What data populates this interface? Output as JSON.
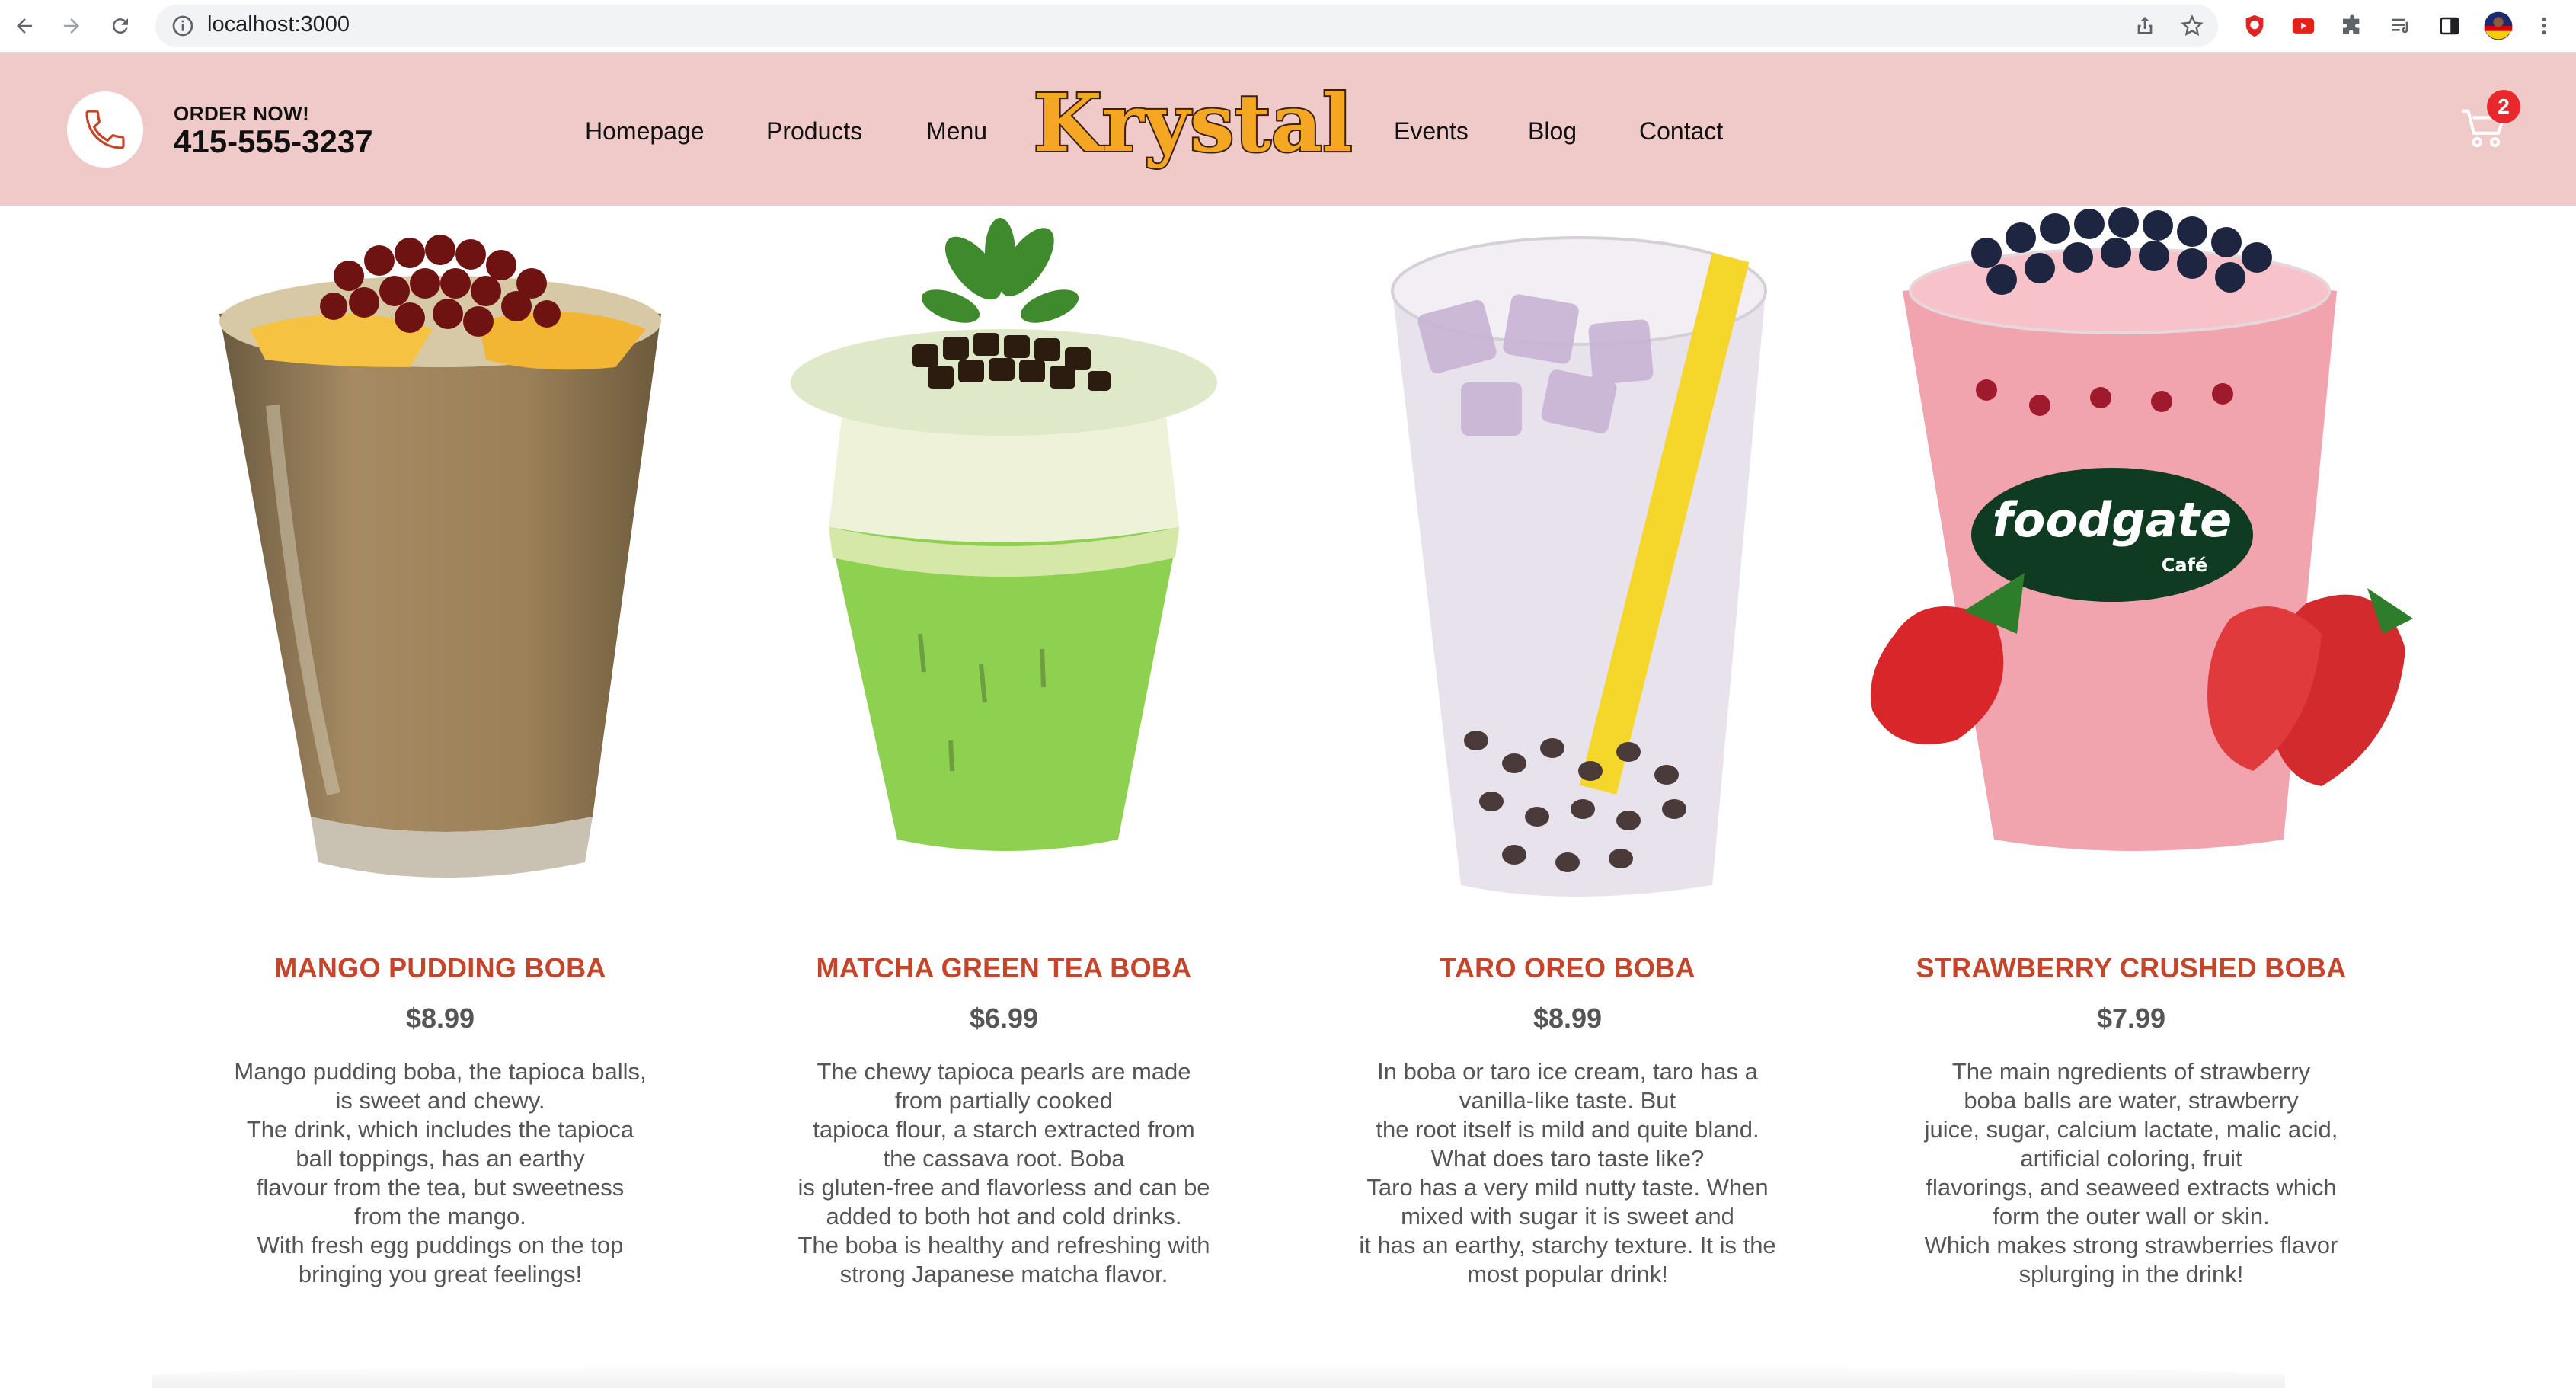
{
  "browser": {
    "url": "localhost:3000",
    "icons": [
      "back-icon",
      "forward-icon",
      "reload-icon",
      "info-icon",
      "share-icon",
      "star-icon",
      "extension-icon",
      "puzzle-icon",
      "reading-list-icon",
      "side-panel-icon",
      "profile-icon",
      "menu-icon"
    ]
  },
  "header": {
    "order_label": "ORDER NOW!",
    "phone": "415-555-3237",
    "nav": [
      "Homepage",
      "Products",
      "Menu",
      "Events",
      "Blog",
      "Contact"
    ],
    "logo": "Krystal",
    "cart_count": "2",
    "colors": {
      "header_bg": "#f0c9c9",
      "logo_fill": "#f5a623",
      "accent": "#c4452a",
      "badge": "#e8282d"
    }
  },
  "products": [
    {
      "name": "MANGO PUDDING BOBA",
      "price": "$8.99",
      "description": [
        "Mango pudding boba, the tapioca balls,",
        "is sweet and chewy.",
        "The drink, which includes the tapioca",
        "ball toppings, has an earthy",
        "flavour from the tea, but sweetness",
        "from the mango.",
        "With fresh egg puddings on the top",
        "bringing you great feelings!"
      ]
    },
    {
      "name": "MATCHA GREEN TEA BOBA",
      "price": "$6.99",
      "description": [
        "The chewy tapioca pearls are made",
        "from partially cooked",
        "tapioca flour, a starch extracted from",
        "the cassava root. Boba",
        "is gluten-free and flavorless and can be",
        "added to both hot and cold drinks.",
        "The boba is healthy and refreshing with",
        "strong Japanese matcha flavor."
      ]
    },
    {
      "name": "TARO OREO BOBA",
      "price": "$8.99",
      "description": [
        "In boba or taro ice cream, taro has a",
        "vanilla-like taste. But",
        "the root itself is mild and quite bland.",
        "What does taro taste like?",
        "Taro has a very mild nutty taste. When",
        "mixed with sugar it is sweet and",
        "it has an earthy, starchy texture. It is the",
        "most popular drink!"
      ]
    },
    {
      "name": "STRAWBERRY CRUSHED BOBA",
      "price": "$7.99",
      "description": [
        "The main ngredients of strawberry",
        "boba balls are water, strawberry",
        "juice, sugar, calcium lactate, malic acid,",
        "artificial coloring, fruit",
        "flavorings, and seaweed extracts which",
        "form the outer wall or skin.",
        "Which makes strong strawberries flavor",
        "splurging in the drink!"
      ],
      "cup_brand": "foodgate",
      "cup_sub": "Café"
    }
  ]
}
